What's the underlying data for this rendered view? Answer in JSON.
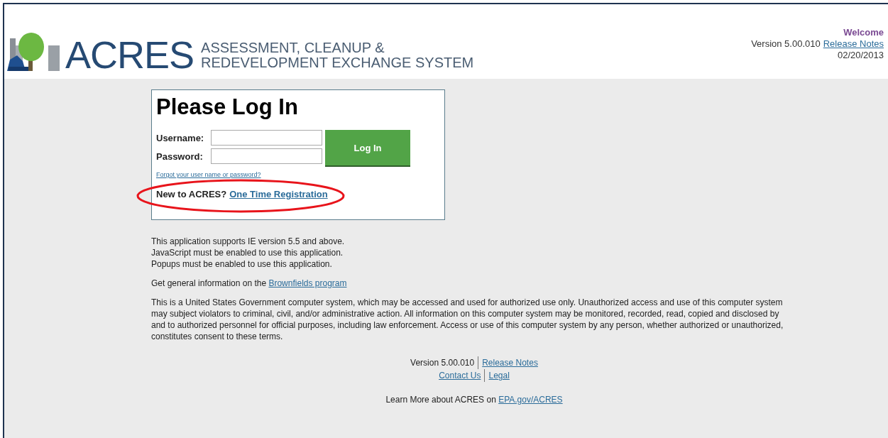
{
  "header": {
    "logo_text": "ACRES",
    "logo_subtitle_1": "ASSESSMENT, CLEANUP &",
    "logo_subtitle_2": "REDEVELOPMENT EXCHANGE SYSTEM",
    "welcome": "Welcome",
    "version": "Version 5.00.010",
    "release_notes": "Release Notes",
    "date": "02/20/2013"
  },
  "login": {
    "title": "Please Log In",
    "username_label": "Username:",
    "password_label": "Password:",
    "button": "Log In",
    "forgot": "Forgot your user name or password?",
    "new_prompt": "New to ACRES?",
    "register": "One Time Registration",
    "highlighted": true
  },
  "requirements": [
    "This application supports IE version 5.5 and above.",
    "JavaScript must be enabled to use this application.",
    "Popups must be enabled to use this application."
  ],
  "info": {
    "text": "Get general information on the ",
    "link": "Brownfields program"
  },
  "disclaimer": "This is a United States Government computer system, which may be accessed and used for authorized use only. Unauthorized access and use of this computer system may subject violators to criminal, civil, and/or administrative action. All information on this computer system may be monitored, recorded, read, copied and disclosed by and to authorized personnel for official purposes, including law enforcement. Access or use of this computer system by any person, whether authorized or unauthorized, constitutes consent to these terms.",
  "footer": {
    "version": "Version 5.00.010",
    "release_notes": "Release Notes",
    "contact": "Contact Us",
    "legal": "Legal",
    "learn_text": "Learn More about ACRES on ",
    "learn_link": "EPA.gov/ACRES"
  }
}
